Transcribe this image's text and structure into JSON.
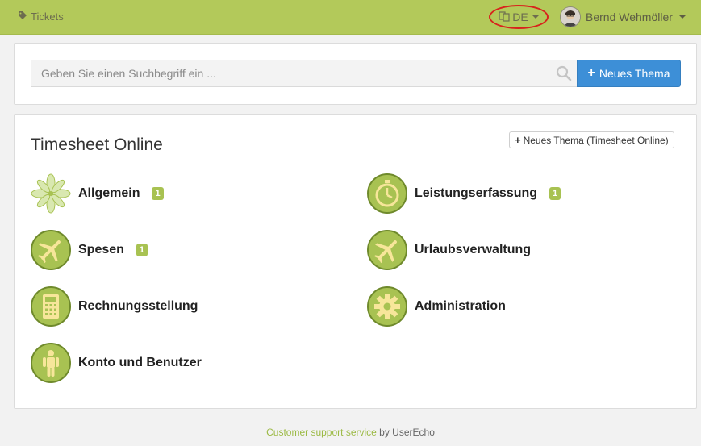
{
  "nav": {
    "tickets_label": "Tickets",
    "language": "DE",
    "user_name": "Bernd Wehmöller"
  },
  "search": {
    "placeholder": "Geben Sie einen Suchbegriff ein ...",
    "value": "",
    "new_topic_label": "Neues Thema"
  },
  "forum": {
    "title": "Timesheet Online",
    "new_topic_label": "Neues Thema (Timesheet Online)",
    "categories": [
      {
        "label": "Allgemein",
        "badge": "1",
        "icon": "flower-icon"
      },
      {
        "label": "Leistungserfassung",
        "badge": "1",
        "icon": "stopwatch-icon"
      },
      {
        "label": "Spesen",
        "badge": "1",
        "icon": "airplane-icon"
      },
      {
        "label": "Urlaubsverwaltung",
        "badge": "",
        "icon": "airplane-icon"
      },
      {
        "label": "Rechnungsstellung",
        "badge": "",
        "icon": "calculator-icon"
      },
      {
        "label": "Administration",
        "badge": "",
        "icon": "gear-icon"
      },
      {
        "label": "Konto und Benutzer",
        "badge": "",
        "icon": "person-icon"
      }
    ]
  },
  "footer": {
    "link_text": "Customer support service",
    "suffix": "by UserEcho"
  },
  "colors": {
    "navbar": "#b3c95a",
    "accent_blue": "#3d8fd7",
    "badge_green": "#a8c252",
    "icon_green": "#a8c252",
    "highlight_red": "#d8231c"
  }
}
